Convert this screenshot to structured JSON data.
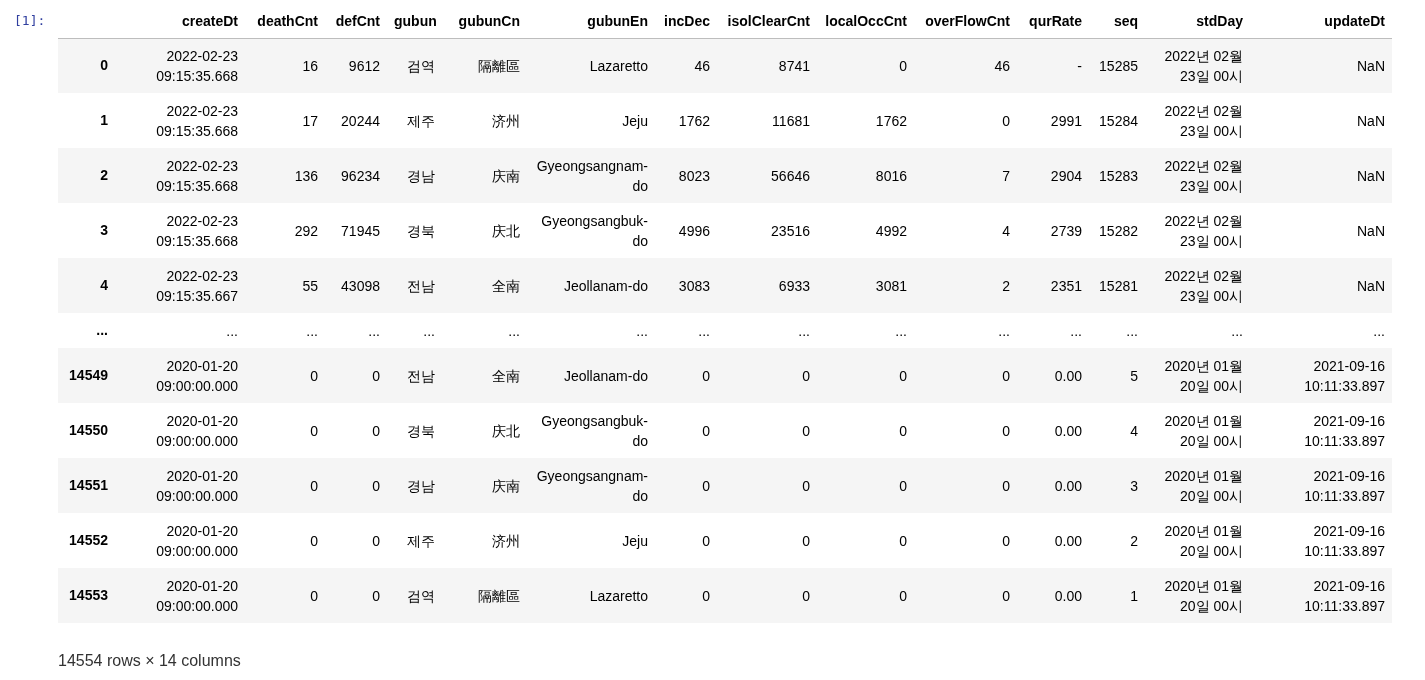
{
  "prompt": "[1]:",
  "table": {
    "columns": [
      "createDt",
      "deathCnt",
      "defCnt",
      "gubun",
      "gubunCn",
      "gubunEn",
      "incDec",
      "isolClearCnt",
      "localOccCnt",
      "overFlowCnt",
      "qurRate",
      "seq",
      "stdDay",
      "updateDt"
    ],
    "rows": [
      {
        "index": "0",
        "cells": [
          "2022-02-23 09:15:35.668",
          "16",
          "9612",
          "검역",
          "隔離區",
          "Lazaretto",
          "46",
          "8741",
          "0",
          "46",
          "-",
          "15285",
          "2022년 02월 23일 00시",
          "NaN"
        ]
      },
      {
        "index": "1",
        "cells": [
          "2022-02-23 09:15:35.668",
          "17",
          "20244",
          "제주",
          "济州",
          "Jeju",
          "1762",
          "11681",
          "1762",
          "0",
          "2991",
          "15284",
          "2022년 02월 23일 00시",
          "NaN"
        ]
      },
      {
        "index": "2",
        "cells": [
          "2022-02-23 09:15:35.668",
          "136",
          "96234",
          "경남",
          "庆南",
          "Gyeongsangnam-do",
          "8023",
          "56646",
          "8016",
          "7",
          "2904",
          "15283",
          "2022년 02월 23일 00시",
          "NaN"
        ]
      },
      {
        "index": "3",
        "cells": [
          "2022-02-23 09:15:35.668",
          "292",
          "71945",
          "경북",
          "庆北",
          "Gyeongsangbuk-do",
          "4996",
          "23516",
          "4992",
          "4",
          "2739",
          "15282",
          "2022년 02월 23일 00시",
          "NaN"
        ]
      },
      {
        "index": "4",
        "cells": [
          "2022-02-23 09:15:35.667",
          "55",
          "43098",
          "전남",
          "全南",
          "Jeollanam-do",
          "3083",
          "6933",
          "3081",
          "2",
          "2351",
          "15281",
          "2022년 02월 23일 00시",
          "NaN"
        ]
      },
      {
        "index": "...",
        "cells": [
          "...",
          "...",
          "...",
          "...",
          "...",
          "...",
          "...",
          "...",
          "...",
          "...",
          "...",
          "...",
          "...",
          "..."
        ]
      },
      {
        "index": "14549",
        "cells": [
          "2020-01-20 09:00:00.000",
          "0",
          "0",
          "전남",
          "全南",
          "Jeollanam-do",
          "0",
          "0",
          "0",
          "0",
          "0.00",
          "5",
          "2020년 01월 20일 00시",
          "2021-09-16 10:11:33.897"
        ]
      },
      {
        "index": "14550",
        "cells": [
          "2020-01-20 09:00:00.000",
          "0",
          "0",
          "경북",
          "庆北",
          "Gyeongsangbuk-do",
          "0",
          "0",
          "0",
          "0",
          "0.00",
          "4",
          "2020년 01월 20일 00시",
          "2021-09-16 10:11:33.897"
        ]
      },
      {
        "index": "14551",
        "cells": [
          "2020-01-20 09:00:00.000",
          "0",
          "0",
          "경남",
          "庆南",
          "Gyeongsangnam-do",
          "0",
          "0",
          "0",
          "0",
          "0.00",
          "3",
          "2020년 01월 20일 00시",
          "2021-09-16 10:11:33.897"
        ]
      },
      {
        "index": "14552",
        "cells": [
          "2020-01-20 09:00:00.000",
          "0",
          "0",
          "제주",
          "济州",
          "Jeju",
          "0",
          "0",
          "0",
          "0",
          "0.00",
          "2",
          "2020년 01월 20일 00시",
          "2021-09-16 10:11:33.897"
        ]
      },
      {
        "index": "14553",
        "cells": [
          "2020-01-20 09:00:00.000",
          "0",
          "0",
          "검역",
          "隔離區",
          "Lazaretto",
          "0",
          "0",
          "0",
          "0",
          "0.00",
          "1",
          "2020년 01월 20일 00시",
          "2021-09-16 10:11:33.897"
        ]
      }
    ]
  },
  "footer": "14554 rows × 14 columns"
}
